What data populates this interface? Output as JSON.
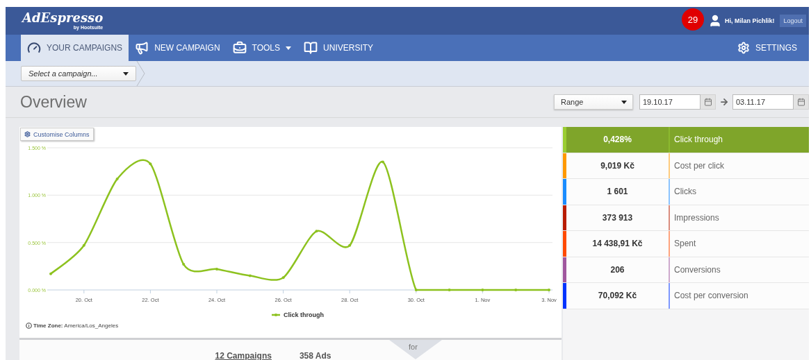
{
  "header": {
    "logo": "AdEspresso",
    "logo_sub": "by Hootsuite",
    "notification_count": "29",
    "greeting": "Hi, Milan Pichlik!",
    "logout": "Logout"
  },
  "nav": {
    "items": [
      {
        "label": "YOUR CAMPAIGNS",
        "selected": true,
        "dropdown": false
      },
      {
        "label": "NEW CAMPAIGN",
        "selected": false,
        "dropdown": false
      },
      {
        "label": "TOOLS",
        "selected": false,
        "dropdown": true
      },
      {
        "label": "UNIVERSITY",
        "selected": false,
        "dropdown": false
      }
    ],
    "settings": "SETTINGS"
  },
  "breadcrumb": {
    "placeholder": "Select a campaign..."
  },
  "overview": {
    "title": "Overview",
    "range": "Range",
    "date_from": "19.10.17",
    "date_to": "03.11.17"
  },
  "chart_panel": {
    "customise_button": "Customise Columns",
    "timezone_label": "Time Zone:",
    "timezone": "America/Los_Angeles",
    "chart_data": {
      "type": "line",
      "categories": [
        null,
        "20. Oct",
        null,
        "22. Oct",
        null,
        "24. Oct",
        null,
        "26. Oct",
        null,
        "28. Oct",
        null,
        "30. Oct",
        null,
        "1. Nov",
        null,
        "3. Nov"
      ],
      "series": [
        {
          "name": "Click through",
          "color": "#8dc21f",
          "values": [
            0.17,
            0.47,
            1.17,
            1.33,
            0.27,
            0.22,
            0.15,
            0.13,
            0.62,
            0.47,
            1.35,
            0,
            0,
            0,
            0,
            0
          ]
        }
      ],
      "ylim": [
        0,
        1.5
      ],
      "yticks": [
        {
          "value": 0,
          "label": "0.000 %"
        },
        {
          "value": 0.5,
          "label": "0.500 %"
        },
        {
          "value": 1,
          "label": "1.000 %"
        },
        {
          "value": 1.5,
          "label": "1.500 %"
        }
      ]
    }
  },
  "metrics": [
    {
      "value": "0,428%",
      "label": "Click through",
      "color": "#9acd32",
      "selected": true
    },
    {
      "value": "9,019 Kč",
      "label": "Cost per click",
      "color": "#ff9900",
      "selected": false
    },
    {
      "value": "1 601",
      "label": "Clicks",
      "color": "#1a8cff",
      "selected": false
    },
    {
      "value": "373 913",
      "label": "Impressions",
      "color": "#b81c00",
      "selected": false
    },
    {
      "value": "14 438,91 Kč",
      "label": "Spent",
      "color": "#ff4a00",
      "selected": false
    },
    {
      "value": "206",
      "label": "Conversions",
      "color": "#a0579e",
      "selected": false
    },
    {
      "value": "70,092 Kč",
      "label": "Cost per conversion",
      "color": "#0033ff",
      "selected": false
    }
  ],
  "summary": {
    "for": "for",
    "campaigns": "12 Campaigns",
    "ads": "358 Ads"
  }
}
